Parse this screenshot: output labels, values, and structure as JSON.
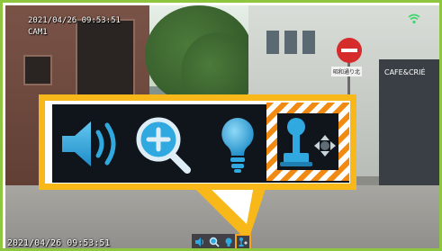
{
  "osd": {
    "timestamp_top": "2021/04/26 09:53:51",
    "camera": "CAM1",
    "timestamp_bottom": "2021/04/26 09:53:51"
  },
  "scene": {
    "sign_shop": "CAFE&CRIÉ",
    "sign_street": "昭和通り北"
  },
  "toolbar": {
    "buttons": [
      {
        "icon": "speaker-icon",
        "label": "Audio"
      },
      {
        "icon": "zoom-in-icon",
        "label": "Zoom"
      },
      {
        "icon": "lightbulb-icon",
        "label": "Light"
      },
      {
        "icon": "ptz-joystick-icon",
        "label": "PTZ",
        "highlighted": true
      }
    ]
  },
  "colors": {
    "frame": "#8fc63f",
    "callout": "#f9b81a",
    "highlight": "#f08a12",
    "icon_blue": "#2fa9e0"
  }
}
